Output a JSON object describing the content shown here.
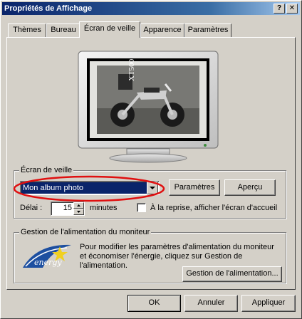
{
  "window": {
    "title": "Propriétés de Affichage",
    "help_glyph": "?",
    "close_glyph": "✕"
  },
  "tabs": [
    {
      "label": "Thèmes"
    },
    {
      "label": "Bureau"
    },
    {
      "label": "Écran de veille",
      "active": true
    },
    {
      "label": "Apparence"
    },
    {
      "label": "Paramètres"
    }
  ],
  "preview": {
    "photo_text": "XT500",
    "icon": "monitor-preview-icon"
  },
  "screensaver": {
    "group_label": "Écran de veille",
    "selected": "Mon album photo",
    "settings_button": "Paramètres",
    "preview_button": "Aperçu",
    "delay_label": "Délai :",
    "delay_value": "15",
    "delay_unit": "minutes",
    "resume_label": "À la reprise, afficher l'écran d'accueil",
    "resume_checked": false,
    "highlight_color": "#e01010"
  },
  "power": {
    "group_label": "Gestion de l'alimentation du moniteur",
    "logo_text": "energy",
    "description": "Pour modifier les paramètres d'alimentation du moniteur et économiser l'énergie, cliquez sur Gestion de l'alimentation.",
    "button": "Gestion de l'alimentation..."
  },
  "footer": {
    "ok": "OK",
    "cancel": "Annuler",
    "apply": "Appliquer"
  },
  "colors": {
    "face": "#d4d0c8",
    "title_start": "#0a246a",
    "title_end": "#a6caf0",
    "selection": "#0a246a"
  }
}
